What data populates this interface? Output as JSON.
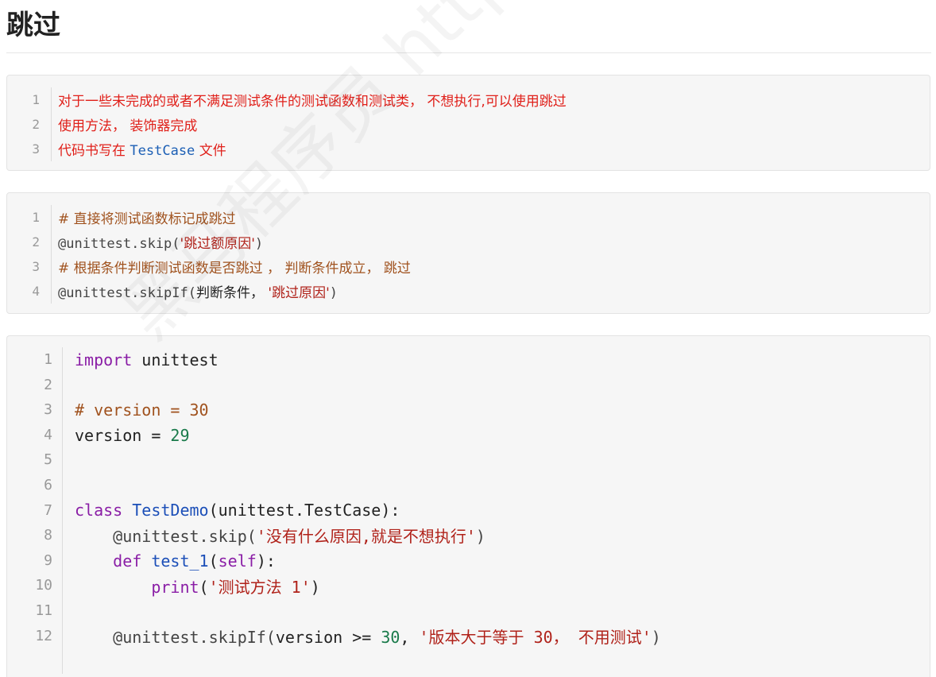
{
  "heading": "跳过",
  "watermark": "黑马程序员 http://",
  "block1": {
    "line_numbers": [
      "1",
      "2",
      "3"
    ],
    "line1": "对于一些未完成的或者不满足测试条件的测试函数和测试类， 不想执行,可以使用跳过",
    "line2": "使用方法， 装饰器完成",
    "line3_prefix": "代码书写在 ",
    "line3_code": "TestCase",
    "line3_suffix": " 文件"
  },
  "block2": {
    "line_numbers": [
      "1",
      "2",
      "3",
      "4"
    ],
    "line1_comment": "# 直接将测试函数标记成跳过",
    "line2_code": "@unittest.skip(",
    "line2_str": "'跳过额原因'",
    "line2_end": ")",
    "line3_comment": "# 根据条件判断测试函数是否跳过 ， 判断条件成立， 跳过",
    "line4_code": "@unittest.skipIf(",
    "line4_cond": "判断条件， ",
    "line4_str": "'跳过原因'",
    "line4_end": ")"
  },
  "block3": {
    "line_numbers": [
      "1",
      "2",
      "3",
      "4",
      "5",
      "6",
      "7",
      "8",
      "9",
      "10",
      "11",
      "12"
    ],
    "l1_kw": "import",
    "l1_rest": " unittest",
    "l3_comment": "# version = 30",
    "l4_var": "version = ",
    "l4_num": "29",
    "l7_kw": "class ",
    "l7_name": "TestDemo",
    "l7_rest": "(unittest.TestCase):",
    "l8_indent": "    ",
    "l8_dec": "@unittest.skip(",
    "l8_str": "'没有什么原因,就是不想执行'",
    "l8_end": ")",
    "l9_indent": "    ",
    "l9_kw": "def ",
    "l9_name": "test_1",
    "l9_paren": "(",
    "l9_self": "self",
    "l9_end": "):",
    "l10_indent": "        ",
    "l10_fn": "print",
    "l10_paren": "(",
    "l10_str": "'测试方法 1'",
    "l10_end": ")",
    "l12_indent": "    ",
    "l12_dec": "@unittest.skipIf(",
    "l12_var": "version >= ",
    "l12_num": "30",
    "l12_comma": ", ",
    "l12_str": "'版本大于等于 30， 不用测试'",
    "l12_end": ")"
  }
}
